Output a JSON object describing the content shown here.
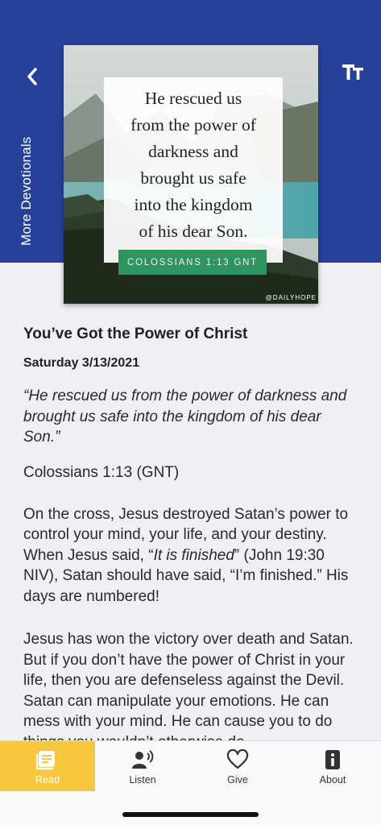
{
  "header": {
    "more_devotionals_label": "More Devotionals",
    "brand_color": "#27409a",
    "back_icon": "chevron-left-icon",
    "text_size_icon": "text-size-icon"
  },
  "hero": {
    "verse_lines": [
      "He rescued us",
      "from the power of",
      "darkness and",
      "brought us safe",
      "into the kingdom",
      "of his dear Son."
    ],
    "reference": "COLOSSIANS 1:13 GNT",
    "watermark": "@DAILYHOPE",
    "reference_color": "#2f9461"
  },
  "devotional": {
    "title": "You’ve Got the Power of Christ",
    "date": "Saturday 3/13/2021",
    "quote": "“He rescued us from the power of darkness and brought us safe into the kingdom of his dear Son.”",
    "reference": "Colossians 1:13 (GNT)",
    "paragraph1_before": "On the cross, Jesus destroyed Satan’s power to control your mind, your life, and your destiny. When Jesus said, “",
    "paragraph1_italic": "It is finished",
    "paragraph1_after": "” (John 19:30 NIV), Satan should have said, “I’m finished.” His days are numbered!",
    "paragraph2": "Jesus has won the victory over death and Satan. But if you don’t have the power of Christ in your life, then you are defenseless against the Devil. Satan can manipulate your emotions. He can mess with your mind. He can cause you to do things you wouldn’t otherwise do."
  },
  "tabbar": {
    "accent_color": "#f7c83f",
    "tabs": [
      {
        "label": "Read",
        "icon": "book-icon",
        "active": true
      },
      {
        "label": "Listen",
        "icon": "listen-icon",
        "active": false
      },
      {
        "label": "Give",
        "icon": "heart-icon",
        "active": false
      },
      {
        "label": "About",
        "icon": "info-icon",
        "active": false
      }
    ]
  }
}
